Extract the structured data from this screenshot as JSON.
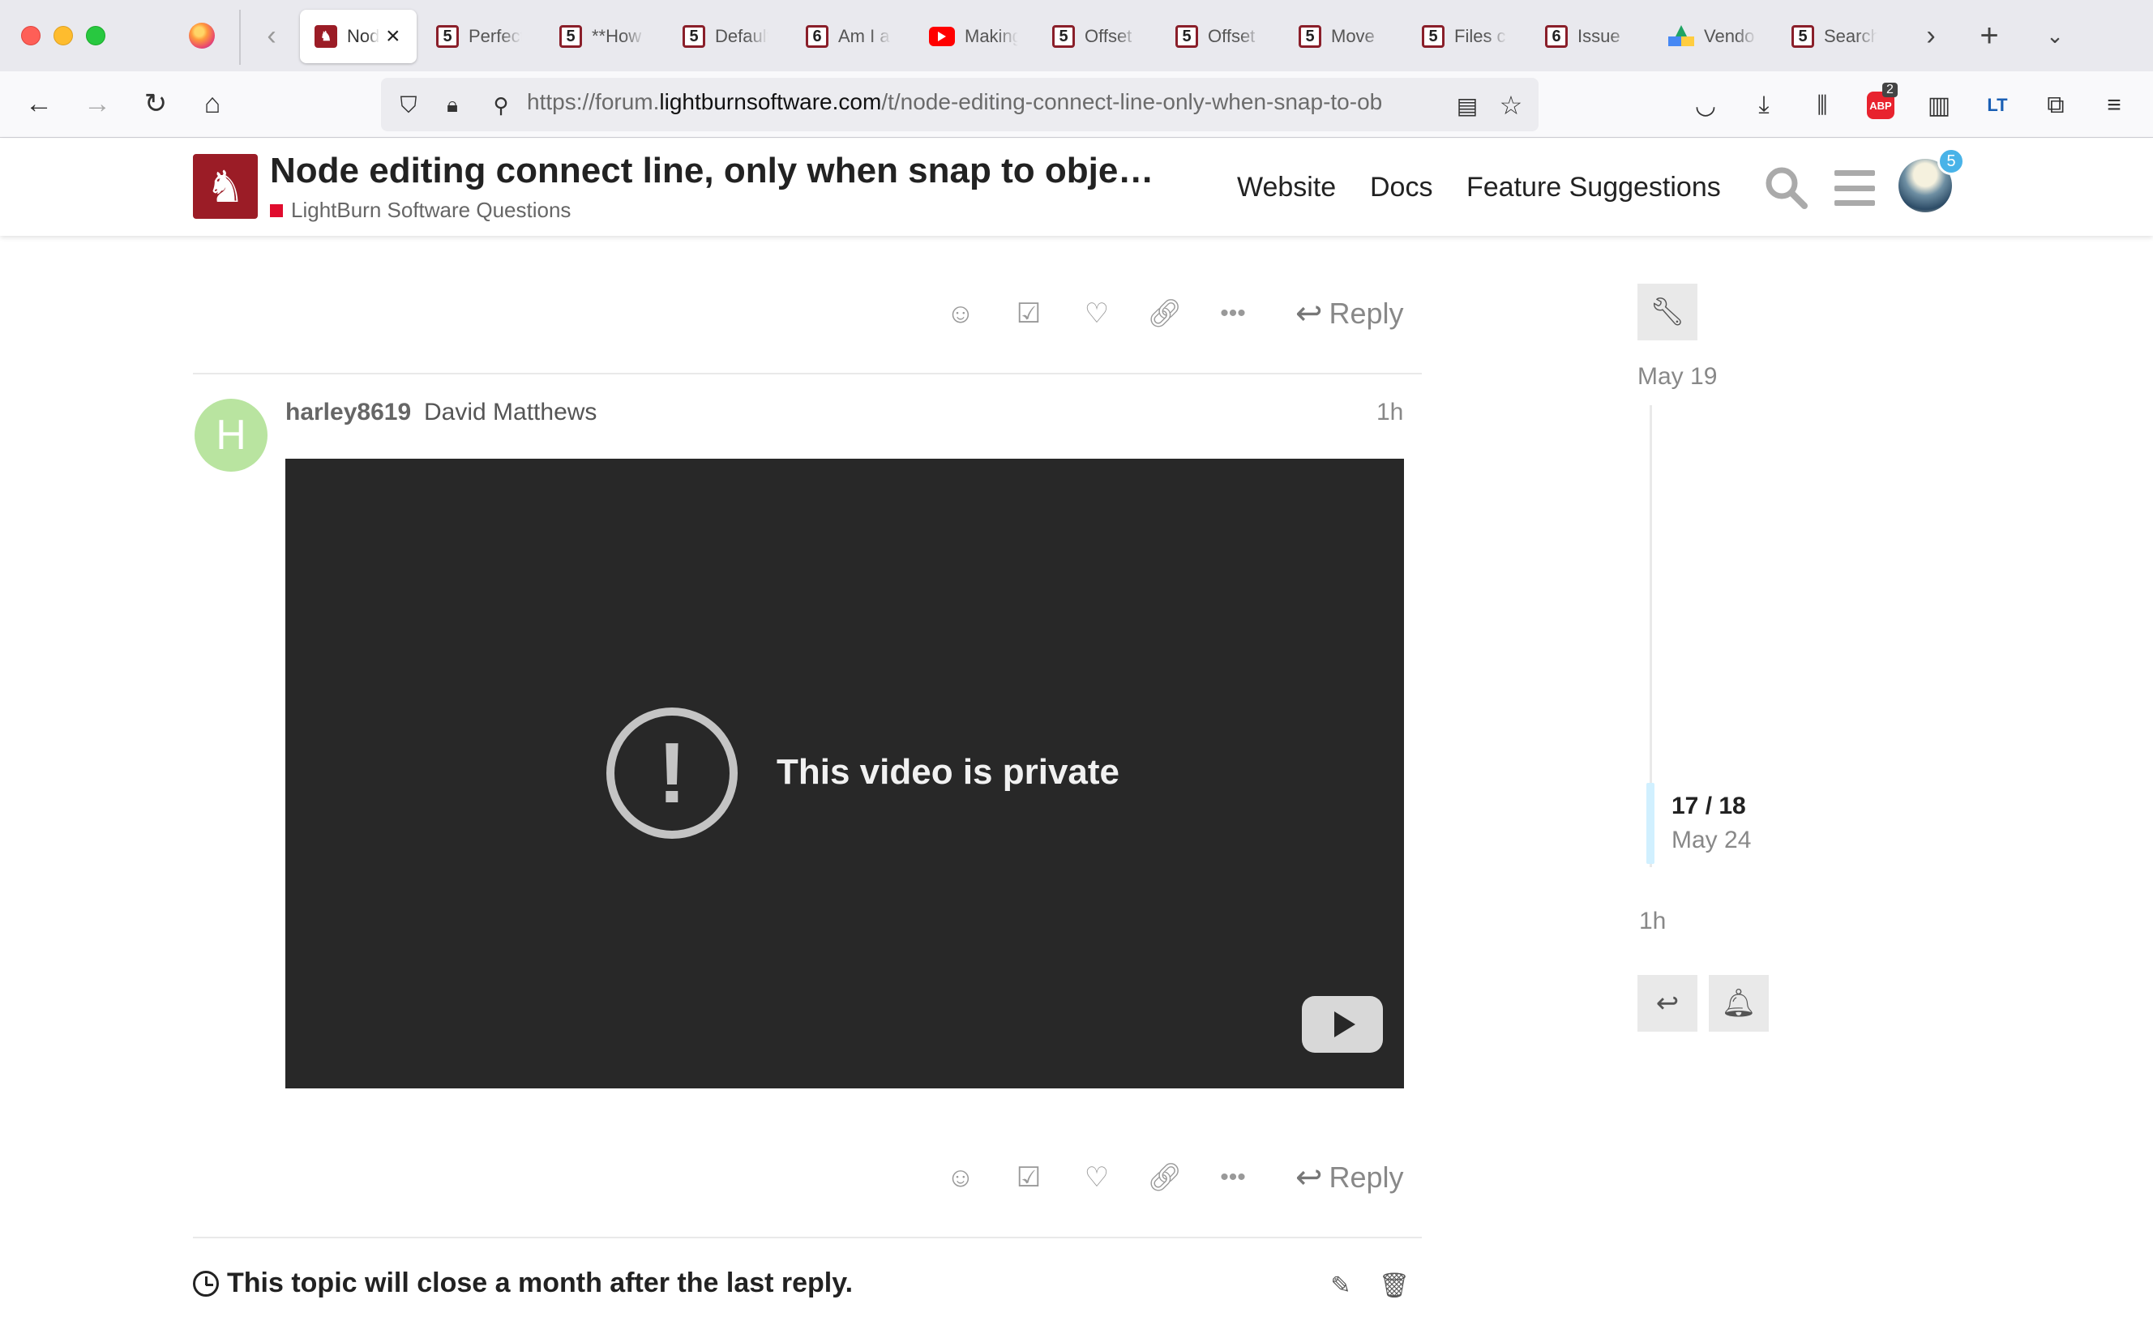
{
  "browser": {
    "tabs": [
      {
        "label": "Node editing connect line",
        "favicon": "lightburn-icon",
        "active": true
      },
      {
        "label": "Perfect",
        "favicon": "discourse-5-icon",
        "badge": "5"
      },
      {
        "label": "**How",
        "favicon": "discourse-5-icon",
        "badge": "5"
      },
      {
        "label": "Default",
        "favicon": "discourse-5-icon",
        "badge": "5"
      },
      {
        "label": "Am I a",
        "favicon": "discourse-6-icon",
        "badge": "6"
      },
      {
        "label": "Making",
        "favicon": "youtube-icon",
        "badge": ""
      },
      {
        "label": "Offset",
        "favicon": "discourse-5-icon",
        "badge": "5"
      },
      {
        "label": "Offset",
        "favicon": "discourse-5-icon",
        "badge": "5"
      },
      {
        "label": "Move",
        "favicon": "discourse-5-icon",
        "badge": "5"
      },
      {
        "label": "Files c",
        "favicon": "discourse-5-icon",
        "badge": "5"
      },
      {
        "label": "Issue",
        "favicon": "discourse-6-icon",
        "badge": "6"
      },
      {
        "label": "Vendo",
        "favicon": "google-drive-icon",
        "badge": ""
      },
      {
        "label": "Search",
        "favicon": "discourse-5-icon",
        "badge": "5"
      }
    ],
    "url_prefix": "https://forum.",
    "url_domain": "lightburnsoftware.com",
    "url_path": "/t/node-editing-connect-line-only-when-snap-to-ob",
    "adblock_count": "2",
    "accent_color": "#9b1c26"
  },
  "header": {
    "topic_title": "Node editing connect line, only when snap to obje…",
    "category": "LightBurn Software Questions",
    "category_color": "#e00c2d",
    "links": [
      "Website",
      "Docs",
      "Feature Suggestions"
    ],
    "notification_count": "5"
  },
  "post": {
    "avatar_letter": "H",
    "username": "harley8619",
    "full_name": "David Matthews",
    "age": "1h",
    "video_message": "This video is private",
    "reply_label": "Reply"
  },
  "prev_post": {
    "reply_label": "Reply"
  },
  "topic_notice": "This topic will close a month after the last reply.",
  "timeline": {
    "start_date": "May 19",
    "position": "17 / 18",
    "position_date": "May 24",
    "end_label": "1h"
  }
}
